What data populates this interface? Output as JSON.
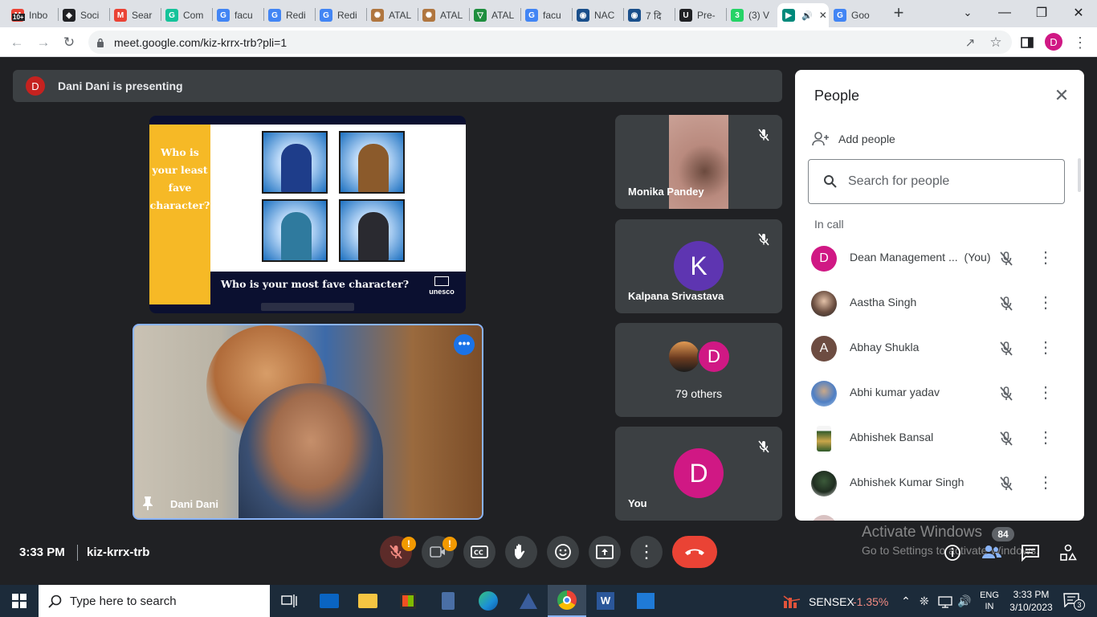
{
  "browser": {
    "tabs": [
      {
        "label": "Inbo",
        "icon": "gmail-icon"
      },
      {
        "label": "Soci",
        "icon": "social-icon"
      },
      {
        "label": "Sear",
        "icon": "gmail-icon"
      },
      {
        "label": "Com",
        "icon": "grammarly-icon"
      },
      {
        "label": "facu",
        "icon": "google-icon"
      },
      {
        "label": "Redi",
        "icon": "google-icon"
      },
      {
        "label": "Redi",
        "icon": "google-icon"
      },
      {
        "label": "ATAL",
        "icon": "atal-icon"
      },
      {
        "label": "ATAL",
        "icon": "atal-icon"
      },
      {
        "label": "ATAL",
        "icon": "shield-icon"
      },
      {
        "label": "facu",
        "icon": "google-icon"
      },
      {
        "label": "NAC",
        "icon": "nac-icon"
      },
      {
        "label": "7 दि",
        "icon": "nac-icon"
      },
      {
        "label": "Pre-",
        "icon": "u-icon"
      },
      {
        "label": "(3) V",
        "icon": "whatsapp-icon"
      },
      {
        "label": "",
        "icon": "meet-icon"
      },
      {
        "label": "Goo",
        "icon": "google-icon"
      }
    ],
    "gmail_badge": "10+",
    "url": "meet.google.com/kiz-krrx-trb?pli=1",
    "profile_initial": "D"
  },
  "meet": {
    "presenting_banner": "Dani Dani is presenting",
    "presenter_initial": "D",
    "slide": {
      "left_text": "Who is your least fave character?",
      "caption": "Who is your most fave character?",
      "logo_text": "UNESCO"
    },
    "presenter_name": "Dani Dani",
    "tiles": [
      {
        "name": "Monika Pandey"
      },
      {
        "name": "Kalpana Srivastava",
        "initial": "K"
      },
      {
        "name": "79 others",
        "initial": "D"
      },
      {
        "name": "You",
        "initial": "D"
      }
    ],
    "people_panel": {
      "title": "People",
      "add_people": "Add people",
      "search_placeholder": "Search for people",
      "section": "In call",
      "participants": [
        {
          "name": "Dean Management ...",
          "suffix": "(You)",
          "initial": "D"
        },
        {
          "name": "Aastha Singh"
        },
        {
          "name": "Abhay Shukla",
          "initial": "A"
        },
        {
          "name": "Abhi kumar yadav"
        },
        {
          "name": "Abhishek Bansal"
        },
        {
          "name": "Abhishek Kumar Singh"
        }
      ]
    },
    "time": "3:33 PM",
    "meeting_code": "kiz-krrx-trb",
    "participants_badge": "84",
    "badge_alert": "!"
  },
  "watermark": {
    "line1": "Activate Windows",
    "line2": "Go to Settings to activate Windows."
  },
  "taskbar": {
    "search_placeholder": "Type here to search",
    "sensex_label": "SENSEX",
    "sensex_change": "-1.35%",
    "lang_top": "ENG",
    "lang_bottom": "IN",
    "clock_time": "3:33 PM",
    "clock_date": "3/10/2023",
    "notification_count": "3"
  },
  "colors": {
    "meet_bg": "#202124",
    "tile_bg": "#3c4043",
    "end_call_red": "#ea4335",
    "avatar_red": "#c5221f",
    "avatar_pink": "#d01884",
    "avatar_purple": "#5e35b1",
    "sensex_red": "#f28b82"
  }
}
